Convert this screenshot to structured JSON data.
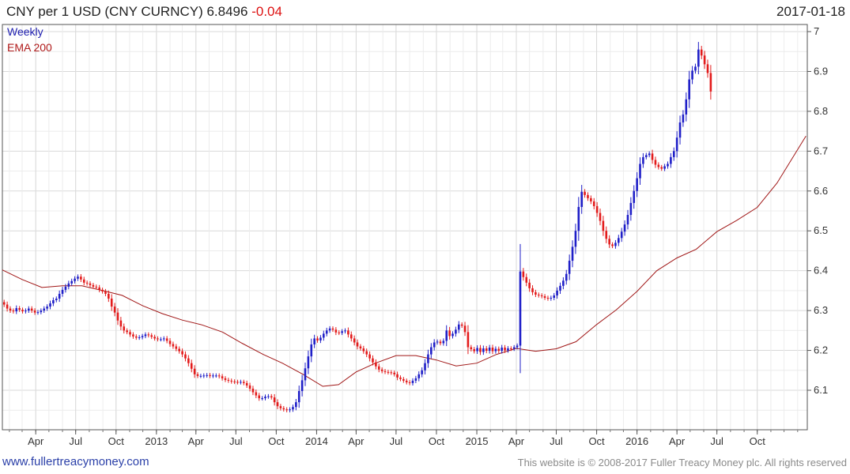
{
  "header": {
    "title_main": "CNY per 1 USD (CNY CURNCY) 6.8496",
    "title_change": "-0.04",
    "date": "2017-01-18"
  },
  "footer": {
    "left": "www.fullertreacymoney.com",
    "right": "This website is © 2008-2017 Fuller Treacy Money plc. All rights reserved"
  },
  "colors": {
    "up": "#1f1fc8",
    "down": "#e31b1b",
    "ema": "#a01616",
    "grid": "#d9d9d9",
    "legend_weekly": "#2020b0",
    "legend_ema": "#b01a1a"
  },
  "chart_data": {
    "type": "line",
    "legend": [
      "Weekly",
      "EMA 200"
    ],
    "legend_position": "top-left",
    "grid": true,
    "ylim": [
      6.0,
      7.0
    ],
    "yticks": [
      6.1,
      6.2,
      6.3,
      6.4,
      6.5,
      6.6,
      6.7,
      6.8,
      6.9,
      7
    ],
    "ytick_labels": [
      "6.1",
      "6.2",
      "6.3",
      "6.4",
      "6.5",
      "6.6",
      "6.7",
      "6.8",
      "6.9",
      "7"
    ],
    "xlim": [
      "2012-01-16",
      "2017-01-23"
    ],
    "xticks": [
      {
        "date": "2012-04-01",
        "label": "Apr"
      },
      {
        "date": "2012-07-01",
        "label": "Jul"
      },
      {
        "date": "2012-10-01",
        "label": "Oct"
      },
      {
        "date": "2013-01-01",
        "label": "2013"
      },
      {
        "date": "2013-04-01",
        "label": "Apr"
      },
      {
        "date": "2013-07-01",
        "label": "Jul"
      },
      {
        "date": "2013-10-01",
        "label": "Oct"
      },
      {
        "date": "2014-01-01",
        "label": "2014"
      },
      {
        "date": "2014-04-01",
        "label": "Apr"
      },
      {
        "date": "2014-07-01",
        "label": "Jul"
      },
      {
        "date": "2014-10-01",
        "label": "Oct"
      },
      {
        "date": "2015-01-01",
        "label": "2015"
      },
      {
        "date": "2015-04-01",
        "label": "Apr"
      },
      {
        "date": "2015-07-01",
        "label": "Jul"
      },
      {
        "date": "2015-10-01",
        "label": "Oct"
      },
      {
        "date": "2016-01-01",
        "label": "2016"
      },
      {
        "date": "2016-04-01",
        "label": "Apr"
      },
      {
        "date": "2016-07-01",
        "label": "Jul"
      },
      {
        "date": "2016-10-01",
        "label": "Oct"
      }
    ],
    "series": [
      {
        "name": "Weekly",
        "kind": "candlestick",
        "x_start": "2012-01-20",
        "x_step_days": 7,
        "close": [
          6.315,
          6.305,
          6.3,
          6.298,
          6.306,
          6.302,
          6.298,
          6.3,
          6.305,
          6.3,
          6.295,
          6.296,
          6.3,
          6.305,
          6.31,
          6.318,
          6.326,
          6.33,
          6.342,
          6.352,
          6.36,
          6.368,
          6.374,
          6.38,
          6.385,
          6.378,
          6.37,
          6.368,
          6.364,
          6.36,
          6.358,
          6.352,
          6.348,
          6.342,
          6.33,
          6.31,
          6.295,
          6.275,
          6.26,
          6.25,
          6.246,
          6.24,
          6.235,
          6.232,
          6.233,
          6.236,
          6.24,
          6.238,
          6.234,
          6.23,
          6.228,
          6.228,
          6.23,
          6.224,
          6.216,
          6.21,
          6.204,
          6.198,
          6.19,
          6.18,
          6.168,
          6.154,
          6.14,
          6.136,
          6.136,
          6.137,
          6.138,
          6.136,
          6.137,
          6.137,
          6.135,
          6.13,
          6.126,
          6.124,
          6.122,
          6.121,
          6.12,
          6.121,
          6.118,
          6.112,
          6.104,
          6.095,
          6.087,
          6.08,
          6.08,
          6.084,
          6.085,
          6.082,
          6.07,
          6.06,
          6.055,
          6.052,
          6.05,
          6.052,
          6.058,
          6.07,
          6.098,
          6.125,
          6.155,
          6.185,
          6.215,
          6.23,
          6.225,
          6.232,
          6.242,
          6.25,
          6.255,
          6.252,
          6.245,
          6.244,
          6.248,
          6.25,
          6.24,
          6.23,
          6.22,
          6.21,
          6.205,
          6.198,
          6.19,
          6.18,
          6.17,
          6.16,
          6.152,
          6.148,
          6.146,
          6.145,
          6.144,
          6.14,
          6.132,
          6.128,
          6.124,
          6.12,
          6.118,
          6.124,
          6.13,
          6.14,
          6.15,
          6.168,
          6.19,
          6.208,
          6.22,
          6.222,
          6.218,
          6.224,
          6.25,
          6.236,
          6.242,
          6.252,
          6.265,
          6.262,
          6.246,
          6.208,
          6.203,
          6.198,
          6.206,
          6.196,
          6.205,
          6.199,
          6.207,
          6.198,
          6.204,
          6.199,
          6.207,
          6.2,
          6.205,
          6.204,
          6.208,
          6.212,
          6.398,
          6.384,
          6.37,
          6.356,
          6.346,
          6.34,
          6.338,
          6.336,
          6.332,
          6.33,
          6.332,
          6.338,
          6.35,
          6.362,
          6.375,
          6.392,
          6.425,
          6.46,
          6.5,
          6.56,
          6.598,
          6.59,
          6.582,
          6.574,
          6.562,
          6.545,
          6.525,
          6.5,
          6.48,
          6.466,
          6.462,
          6.47,
          6.482,
          6.498,
          6.516,
          6.54,
          6.57,
          6.6,
          6.632,
          6.668,
          6.685,
          6.69,
          6.694,
          6.678,
          6.666,
          6.66,
          6.656,
          6.662,
          6.668,
          6.685,
          6.7,
          6.734,
          6.772,
          6.792,
          6.83,
          6.88,
          6.902,
          6.912,
          6.955,
          6.94,
          6.918,
          6.896,
          6.8496
        ]
      },
      {
        "name": "EMA 200",
        "kind": "line",
        "points": [
          {
            "x": "2012-01-16",
            "y": 6.402
          },
          {
            "x": "2012-03-01",
            "y": 6.378
          },
          {
            "x": "2012-04-15",
            "y": 6.358
          },
          {
            "x": "2012-06-01",
            "y": 6.362
          },
          {
            "x": "2012-07-15",
            "y": 6.362
          },
          {
            "x": "2012-09-01",
            "y": 6.35
          },
          {
            "x": "2012-10-15",
            "y": 6.338
          },
          {
            "x": "2012-12-01",
            "y": 6.312
          },
          {
            "x": "2013-01-15",
            "y": 6.292
          },
          {
            "x": "2013-03-01",
            "y": 6.276
          },
          {
            "x": "2013-04-15",
            "y": 6.264
          },
          {
            "x": "2013-06-01",
            "y": 6.246
          },
          {
            "x": "2013-07-15",
            "y": 6.218
          },
          {
            "x": "2013-09-01",
            "y": 6.19
          },
          {
            "x": "2013-10-15",
            "y": 6.168
          },
          {
            "x": "2013-12-01",
            "y": 6.14
          },
          {
            "x": "2014-01-15",
            "y": 6.11
          },
          {
            "x": "2014-02-20",
            "y": 6.114
          },
          {
            "x": "2014-04-01",
            "y": 6.146
          },
          {
            "x": "2014-05-15",
            "y": 6.168
          },
          {
            "x": "2014-07-01",
            "y": 6.187
          },
          {
            "x": "2014-08-15",
            "y": 6.187
          },
          {
            "x": "2014-10-01",
            "y": 6.176
          },
          {
            "x": "2014-11-15",
            "y": 6.161
          },
          {
            "x": "2015-01-01",
            "y": 6.168
          },
          {
            "x": "2015-02-15",
            "y": 6.19
          },
          {
            "x": "2015-04-01",
            "y": 6.205
          },
          {
            "x": "2015-05-15",
            "y": 6.198
          },
          {
            "x": "2015-07-01",
            "y": 6.204
          },
          {
            "x": "2015-08-15",
            "y": 6.222
          },
          {
            "x": "2015-10-01",
            "y": 6.265
          },
          {
            "x": "2015-11-15",
            "y": 6.302
          },
          {
            "x": "2016-01-01",
            "y": 6.348
          },
          {
            "x": "2016-02-15",
            "y": 6.4
          },
          {
            "x": "2016-04-01",
            "y": 6.432
          },
          {
            "x": "2016-05-15",
            "y": 6.454
          },
          {
            "x": "2016-07-01",
            "y": 6.498
          },
          {
            "x": "2016-08-15",
            "y": 6.526
          },
          {
            "x": "2016-10-01",
            "y": 6.559
          },
          {
            "x": "2016-11-15",
            "y": 6.62
          },
          {
            "x": "2017-01-20",
            "y": 6.738
          }
        ]
      }
    ]
  }
}
